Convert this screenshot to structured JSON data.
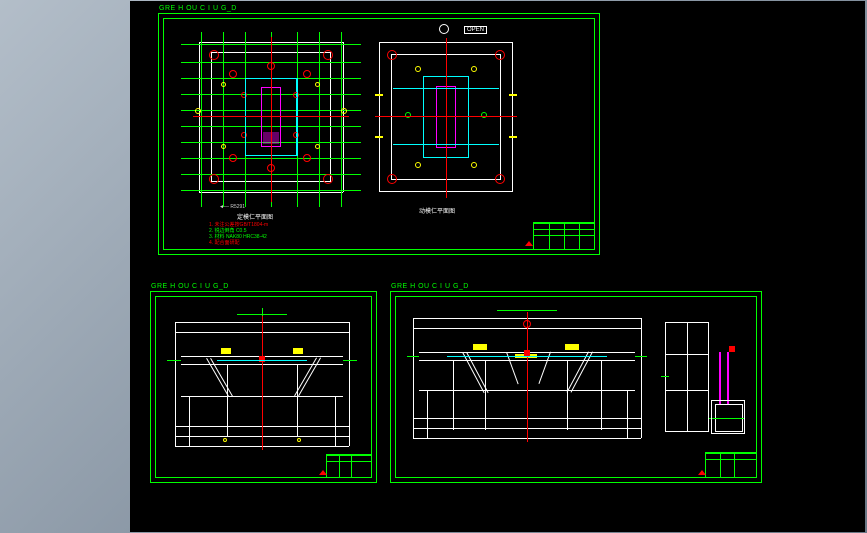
{
  "sheets": {
    "top": {
      "title": "GRE H OU C I U G_D"
    },
    "left": {
      "title": "GRE H OU C I U G_D"
    },
    "right": {
      "title": "GRE H OU C I U G_D"
    }
  },
  "captions": {
    "plan_left": "定模仁平面图",
    "plan_right": "动模仁平面图",
    "reference": "OPEN",
    "direction": "◄— R5291"
  },
  "notes": {
    "line1": "1. 未注公差按GB/T1804-m",
    "line2": "2. 锐边倒角 C0.5",
    "line3": "3. 材料 NAK80 HRC38-42",
    "line4": "4. 配合面研配"
  },
  "chart_data": {
    "type": "diagram",
    "description": "Injection mold engineering drawings — three sheets on dark CAD canvas",
    "views": [
      {
        "name": "cavity-plan",
        "sheet": "top",
        "caption_key": "captions.plan_left"
      },
      {
        "name": "core-plan",
        "sheet": "top",
        "caption_key": "captions.plan_right"
      },
      {
        "name": "section-front",
        "sheet": "left"
      },
      {
        "name": "section-side",
        "sheet": "right"
      },
      {
        "name": "detail-latch",
        "sheet": "right"
      }
    ],
    "colors": {
      "outline": "#00ff00",
      "geometry": "#ffffff",
      "centerlines": "#ff0000",
      "cooling": "#00ffff",
      "ejector": "#ffff00",
      "slider": "#ff00ff"
    }
  }
}
